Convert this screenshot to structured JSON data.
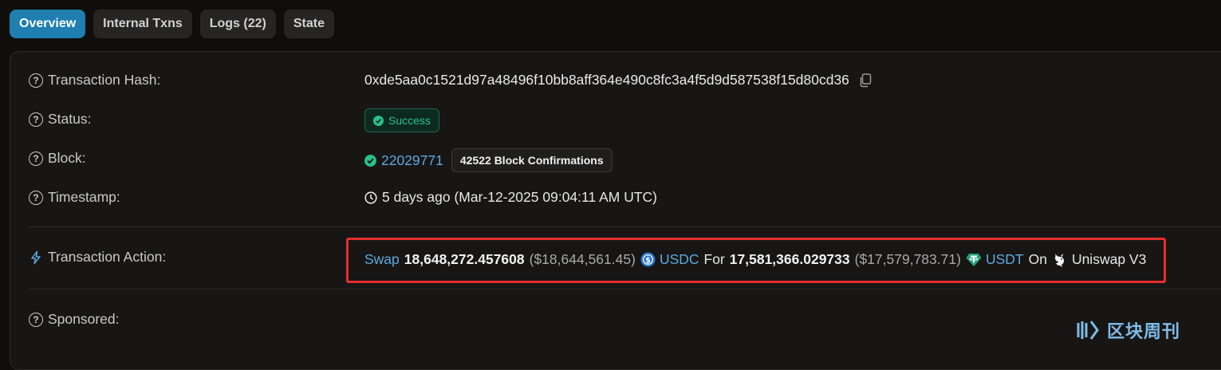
{
  "tabs": [
    {
      "label": "Overview",
      "active": true
    },
    {
      "label": "Internal Txns",
      "active": false
    },
    {
      "label": "Logs (22)",
      "active": false
    },
    {
      "label": "State",
      "active": false
    }
  ],
  "rows": {
    "hash": {
      "label": "Transaction Hash:",
      "value": "0xde5aa0c1521d97a48496f10bb8aff364e490c8fc3a4f5d9d587538f15d80cd36",
      "icon": "copy-icon"
    },
    "status": {
      "label": "Status:",
      "value": "Success"
    },
    "block": {
      "label": "Block:",
      "number": "22029771",
      "confirmations": "42522 Block Confirmations"
    },
    "timestamp": {
      "label": "Timestamp:",
      "value": "5 days ago (Mar-12-2025 09:04:11 AM UTC)"
    },
    "action": {
      "label": "Transaction Action:",
      "verb": "Swap",
      "amount_in": "18,648,272.457608",
      "amount_in_usd": "($18,644,561.45)",
      "token_in": "USDC",
      "for": "For",
      "amount_out": "17,581,366.029733",
      "amount_out_usd": "($17,579,783.71)",
      "token_out": "USDT",
      "on": "On",
      "dex": "Uniswap V3"
    },
    "sponsored": {
      "label": "Sponsored:"
    }
  },
  "watermark": {
    "text": "区块周刊"
  },
  "colors": {
    "accent": "#1e7fb0",
    "success": "#27c08a",
    "link": "#5ea9dd",
    "highlight": "#e62d2d"
  }
}
